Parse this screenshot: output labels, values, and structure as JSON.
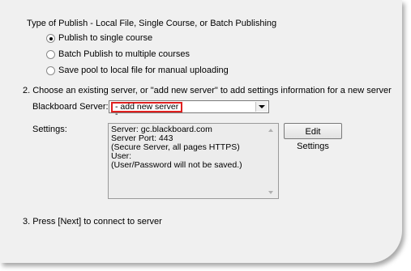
{
  "publish_type": {
    "heading": "Type of Publish - Local File, Single Course, or Batch Publishing",
    "options": [
      {
        "label": "Publish to single course",
        "selected": true
      },
      {
        "label": "Batch Publish to multiple courses",
        "selected": false
      },
      {
        "label": "Save pool to local file for manual uploading",
        "selected": false
      }
    ]
  },
  "server_section": {
    "heading": "2. Choose an existing server, or \"add new server\" to add settings information for a new server",
    "server_label": "Blackboard Server:",
    "server_value": "- add new server -",
    "settings_label": "Settings:",
    "settings_text": "Server: gc.blackboard.com\nServer Port: 443\n(Secure Server, all pages HTTPS)\nUser:\n(User/Password will not be saved.)",
    "edit_button": "Edit Settings"
  },
  "step3": {
    "text": "3. Press [Next] to connect to server"
  },
  "colors": {
    "background": "#f0f0f0",
    "highlight": "#e0201f"
  }
}
